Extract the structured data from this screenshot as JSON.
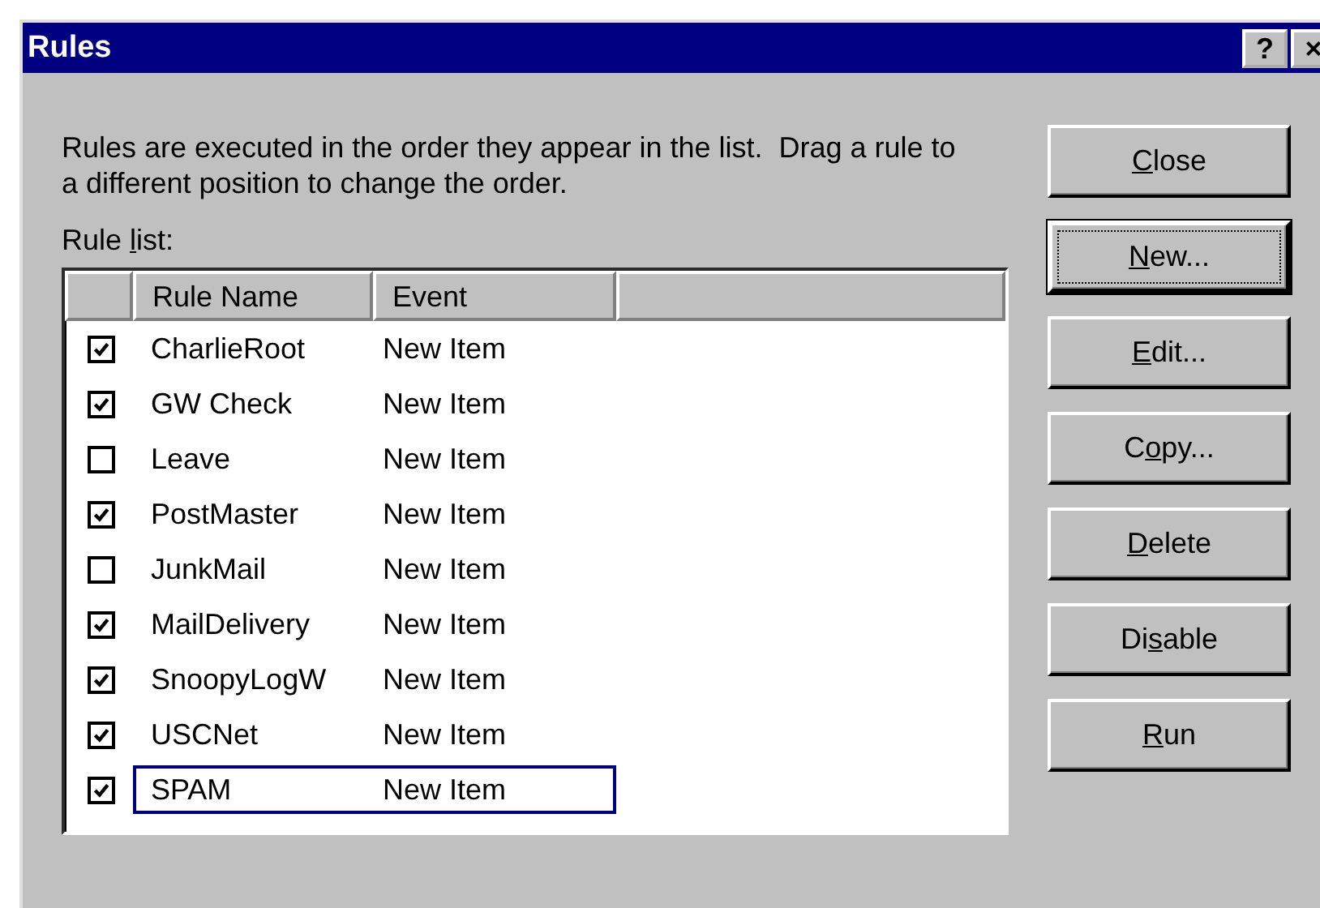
{
  "window": {
    "title": "Rules",
    "title_buttons": [
      "?",
      "×"
    ]
  },
  "description": "Rules are executed in the order they appear in the list.  Drag a rule to a different position to change the order.",
  "list_label": {
    "pre": "Rule ",
    "key": "l",
    "post": "ist:"
  },
  "table": {
    "columns": [
      "Rule Name",
      "Event"
    ],
    "rows": [
      {
        "checked": true,
        "name": "CharlieRoot",
        "event": "New Item",
        "focused": false
      },
      {
        "checked": true,
        "name": "GW Check",
        "event": "New Item",
        "focused": false
      },
      {
        "checked": false,
        "name": "Leave",
        "event": "New Item",
        "focused": false
      },
      {
        "checked": true,
        "name": "PostMaster",
        "event": "New Item",
        "focused": false
      },
      {
        "checked": false,
        "name": "JunkMail",
        "event": "New Item",
        "focused": false
      },
      {
        "checked": true,
        "name": "MailDelivery",
        "event": "New Item",
        "focused": false
      },
      {
        "checked": true,
        "name": "SnoopyLogW",
        "event": "New Item",
        "focused": false
      },
      {
        "checked": true,
        "name": "USCNet",
        "event": "New Item",
        "focused": false
      },
      {
        "checked": true,
        "name": "SPAM",
        "event": "New Item",
        "focused": true
      }
    ]
  },
  "buttons": [
    {
      "key": "C",
      "post": "lose",
      "default": false
    },
    {
      "key": "N",
      "post": "ew...",
      "default": true
    },
    {
      "key": "E",
      "post": "dit...",
      "default": false
    },
    {
      "pre": "C",
      "key": "o",
      "post": "py...",
      "default": false
    },
    {
      "key": "D",
      "post": "elete",
      "default": false
    },
    {
      "pre": "Di",
      "key": "s",
      "post": "able",
      "default": false
    },
    {
      "key": "R",
      "post": "un",
      "default": false
    }
  ]
}
